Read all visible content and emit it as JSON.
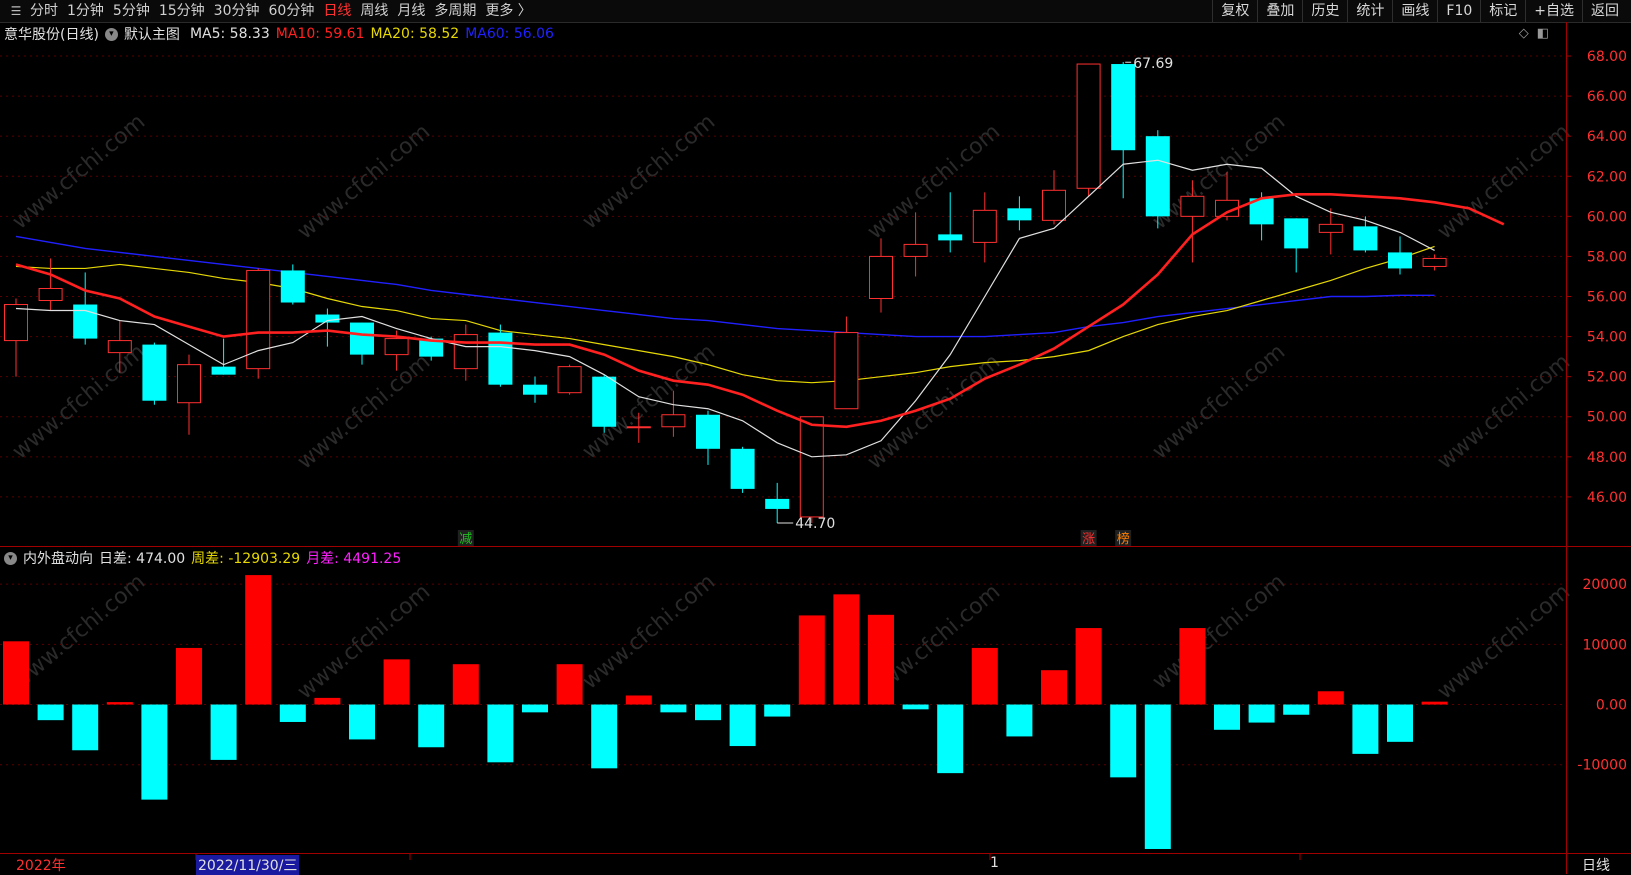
{
  "toolbar": {
    "periods": [
      "分时",
      "1分钟",
      "5分钟",
      "15分钟",
      "30分钟",
      "60分钟",
      "日线",
      "周线",
      "月线",
      "多周期",
      "更多 〉"
    ],
    "active_period": "日线",
    "tools": [
      "复权",
      "叠加",
      "历史",
      "统计",
      "画线",
      "F10",
      "标记",
      "+自选",
      "返回"
    ]
  },
  "main_chart": {
    "stock_title": "意华股份(日线)",
    "template": "默认主图",
    "ma5": {
      "label": "MA5: 58.33",
      "color": "#e0e0e0"
    },
    "ma10": {
      "label": "MA10: 59.61",
      "color": "#ff2020"
    },
    "ma20": {
      "label": "MA20: 58.52",
      "color": "#e6d800"
    },
    "ma60": {
      "label": "MA60: 56.06",
      "color": "#2020ff"
    },
    "high_label": "67.69",
    "low_label": "44.70",
    "markers": [
      {
        "text": "减",
        "color": "#20c020",
        "idx": 13
      },
      {
        "text": "涨",
        "color": "#ff3030",
        "idx": 31
      },
      {
        "text": "榜",
        "color": "#ff7f00",
        "idx": 32
      }
    ]
  },
  "indicator": {
    "name": "内外盘动向",
    "daily": {
      "label": "日差: 474.00",
      "color": "#e0e0e0"
    },
    "weekly": {
      "label": "周差: -12903.29",
      "color": "#e6d800"
    },
    "monthly": {
      "label": "月差: 4491.25",
      "color": "#ff20ff"
    }
  },
  "bottom": {
    "year_label": "2022年",
    "cursor_date": "2022/11/30/三",
    "month_label": "1",
    "period_label": "日线"
  },
  "watermark": "www.cfchi.com",
  "chart_data": {
    "type": "candlestick",
    "price_axis": {
      "ticks": [
        "68.00",
        "66.00",
        "64.00",
        "62.00",
        "60.00",
        "58.00",
        "56.00",
        "54.00",
        "52.00",
        "50.00",
        "48.00",
        "46.00"
      ],
      "range": [
        43.6,
        68.6
      ]
    },
    "indicator_axis": {
      "ticks": [
        "20000",
        "10000",
        "0.00",
        "-10000"
      ],
      "range": [
        -24500,
        26000
      ]
    },
    "candles": [
      {
        "o": 53.8,
        "h": 55.9,
        "l": 52.0,
        "c": 55.6
      },
      {
        "o": 55.8,
        "h": 57.9,
        "l": 55.3,
        "c": 56.4
      },
      {
        "o": 55.6,
        "h": 57.2,
        "l": 53.6,
        "c": 53.9
      },
      {
        "o": 53.2,
        "h": 54.8,
        "l": 52.2,
        "c": 53.8
      },
      {
        "o": 53.6,
        "h": 53.7,
        "l": 50.6,
        "c": 50.8
      },
      {
        "o": 50.7,
        "h": 53.1,
        "l": 49.1,
        "c": 52.6
      },
      {
        "o": 52.5,
        "h": 53.9,
        "l": 52.1,
        "c": 52.1
      },
      {
        "o": 52.4,
        "h": 57.4,
        "l": 51.9,
        "c": 57.3
      },
      {
        "o": 57.3,
        "h": 57.6,
        "l": 55.6,
        "c": 55.7
      },
      {
        "o": 55.1,
        "h": 55.4,
        "l": 53.5,
        "c": 54.7
      },
      {
        "o": 54.7,
        "h": 54.7,
        "l": 52.6,
        "c": 53.1
      },
      {
        "o": 53.1,
        "h": 54.3,
        "l": 52.3,
        "c": 53.9
      },
      {
        "o": 53.9,
        "h": 54.0,
        "l": 52.8,
        "c": 53.0
      },
      {
        "o": 52.4,
        "h": 54.6,
        "l": 51.8,
        "c": 54.1
      },
      {
        "o": 54.2,
        "h": 54.6,
        "l": 51.5,
        "c": 51.6
      },
      {
        "o": 51.6,
        "h": 52.0,
        "l": 50.7,
        "c": 51.1
      },
      {
        "o": 51.2,
        "h": 52.6,
        "l": 51.1,
        "c": 52.5
      },
      {
        "o": 52.0,
        "h": 52.1,
        "l": 49.2,
        "c": 49.5
      },
      {
        "o": 49.5,
        "h": 50.2,
        "l": 48.7,
        "c": 49.5
      },
      {
        "o": 49.5,
        "h": 51.3,
        "l": 49.0,
        "c": 50.1
      },
      {
        "o": 50.1,
        "h": 50.3,
        "l": 47.6,
        "c": 48.4
      },
      {
        "o": 48.4,
        "h": 48.5,
        "l": 46.2,
        "c": 46.4
      },
      {
        "o": 45.9,
        "h": 46.7,
        "l": 44.7,
        "c": 45.4
      },
      {
        "o": 45.0,
        "h": 50.0,
        "l": 44.7,
        "c": 50.0
      },
      {
        "o": 50.4,
        "h": 55.0,
        "l": 50.4,
        "c": 54.2
      },
      {
        "o": 55.9,
        "h": 58.9,
        "l": 55.2,
        "c": 58.0
      },
      {
        "o": 58.0,
        "h": 60.2,
        "l": 57.0,
        "c": 58.6
      },
      {
        "o": 59.1,
        "h": 61.2,
        "l": 58.2,
        "c": 58.8
      },
      {
        "o": 58.7,
        "h": 61.2,
        "l": 57.7,
        "c": 60.3
      },
      {
        "o": 60.4,
        "h": 61.0,
        "l": 59.3,
        "c": 59.8
      },
      {
        "o": 59.8,
        "h": 62.3,
        "l": 59.6,
        "c": 61.3
      },
      {
        "o": 61.4,
        "h": 67.6,
        "l": 61.0,
        "c": 67.6
      },
      {
        "o": 67.6,
        "h": 67.7,
        "l": 60.9,
        "c": 63.3
      },
      {
        "o": 64.0,
        "h": 64.3,
        "l": 59.4,
        "c": 60.0
      },
      {
        "o": 60.0,
        "h": 61.8,
        "l": 57.7,
        "c": 61.0
      },
      {
        "o": 60.0,
        "h": 62.2,
        "l": 59.8,
        "c": 60.8
      },
      {
        "o": 60.9,
        "h": 61.2,
        "l": 58.8,
        "c": 59.6
      },
      {
        "o": 59.9,
        "h": 59.9,
        "l": 57.2,
        "c": 58.4
      },
      {
        "o": 59.2,
        "h": 60.4,
        "l": 58.1,
        "c": 59.6
      },
      {
        "o": 59.5,
        "h": 60.0,
        "l": 58.2,
        "c": 58.3
      },
      {
        "o": 58.2,
        "h": 59.0,
        "l": 57.1,
        "c": 57.4
      },
      {
        "o": 57.5,
        "h": 58.1,
        "l": 57.3,
        "c": 57.9
      }
    ],
    "ma5": [
      55.4,
      55.3,
      55.3,
      54.8,
      54.6,
      53.6,
      52.6,
      53.3,
      53.7,
      54.8,
      55.0,
      54.4,
      53.9,
      53.5,
      53.5,
      53.3,
      53.0,
      52.1,
      51.0,
      50.6,
      50.4,
      49.8,
      48.7,
      48.0,
      48.1,
      48.8,
      50.8,
      53.1,
      56.0,
      58.9,
      59.4,
      61.0,
      62.6,
      62.8,
      62.3,
      62.6,
      62.4,
      61.0,
      60.2,
      59.8,
      59.2,
      58.3
    ],
    "ma10": [
      57.6,
      57.1,
      56.3,
      55.9,
      55.0,
      54.5,
      54.0,
      54.2,
      54.2,
      54.3,
      54.1,
      54.0,
      53.8,
      53.7,
      53.7,
      53.6,
      53.6,
      53.1,
      52.3,
      51.8,
      51.6,
      51.1,
      50.3,
      49.6,
      49.5,
      49.8,
      50.3,
      50.9,
      51.9,
      52.6,
      53.4,
      54.5,
      55.6,
      57.1,
      59.1,
      60.2,
      60.9,
      61.1,
      61.1,
      61.0,
      60.9,
      60.7,
      60.4,
      59.6
    ],
    "ma20": [
      57.5,
      57.4,
      57.4,
      57.6,
      57.4,
      57.2,
      56.9,
      56.7,
      56.4,
      55.9,
      55.5,
      55.3,
      54.9,
      54.8,
      54.3,
      54.1,
      53.9,
      53.6,
      53.3,
      53.0,
      52.6,
      52.1,
      51.8,
      51.7,
      51.8,
      52.0,
      52.2,
      52.5,
      52.7,
      52.8,
      53.0,
      53.3,
      54.0,
      54.6,
      55.0,
      55.3,
      55.8,
      56.3,
      56.8,
      57.4,
      57.9,
      58.5
    ],
    "ma60": [
      59.0,
      58.7,
      58.4,
      58.2,
      58.0,
      57.8,
      57.6,
      57.4,
      57.2,
      57.0,
      56.8,
      56.6,
      56.3,
      56.1,
      55.9,
      55.7,
      55.5,
      55.3,
      55.1,
      54.9,
      54.8,
      54.6,
      54.4,
      54.3,
      54.2,
      54.1,
      54.0,
      54.0,
      54.0,
      54.1,
      54.2,
      54.5,
      54.7,
      55.0,
      55.2,
      55.4,
      55.6,
      55.8,
      56.0,
      56.0,
      56.06,
      56.06
    ],
    "indicator_values": [
      10500,
      -2600,
      -7600,
      400,
      -15800,
      9400,
      -9200,
      21500,
      -2900,
      1100,
      -5800,
      7500,
      -7100,
      6700,
      -9600,
      -1300,
      6700,
      -10600,
      1500,
      -1300,
      -2600,
      -6900,
      -2000,
      14800,
      18300,
      14900,
      -800,
      -11400,
      9400,
      -5300,
      5700,
      12700,
      -12100,
      -24000,
      12700,
      -4200,
      -3000,
      -1700,
      2200,
      -8200,
      -6200,
      474
    ]
  }
}
